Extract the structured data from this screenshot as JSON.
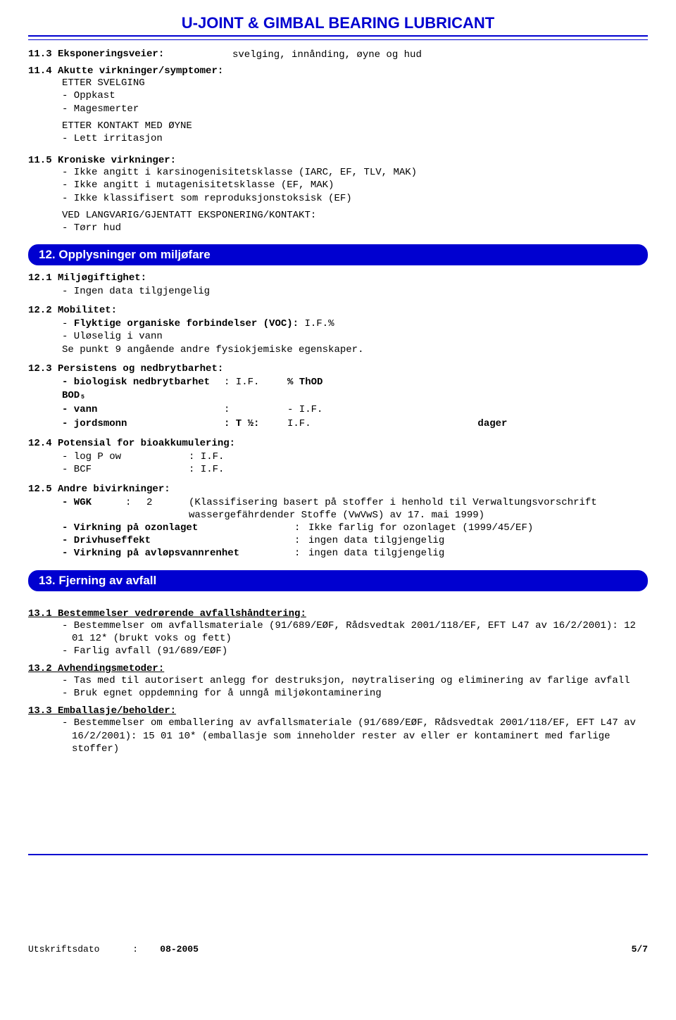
{
  "title": "U-JOINT & GIMBAL BEARING LUBRICANT",
  "s11_3": {
    "label": "11.3 Eksponeringsveier:",
    "value": "svelging, innånding, øyne og hud"
  },
  "s11_4": {
    "label": "11.4 Akutte virkninger/symptomer:",
    "group1_title": "ETTER SVELGING",
    "group1_items": [
      "- Oppkast",
      "- Magesmerter"
    ],
    "group2_title": "ETTER KONTAKT MED ØYNE",
    "group2_items": [
      "- Lett irritasjon"
    ]
  },
  "s11_5": {
    "label": "11.5 Kroniske virkninger:",
    "items": [
      "- Ikke angitt i karsinogenisitetsklasse (IARC, EF, TLV, MAK)",
      "- Ikke angitt i mutagenisitetsklasse (EF, MAK)",
      "- Ikke klassifisert som reproduksjonstoksisk (EF)"
    ],
    "note_title": "VED LANGVARIG/GJENTATT EKSPONERING/KONTAKT:",
    "note_items": [
      "- Tørr hud"
    ]
  },
  "s12": {
    "header": "12.  Opplysninger om miljøfare",
    "s12_1": {
      "label": "12.1 Miljøgiftighet:",
      "items": [
        "- Ingen data tilgjengelig"
      ]
    },
    "s12_2": {
      "label": "12.2 Mobilitet:",
      "item1_pre": "- ",
      "item1_bold": "Flyktige organiske forbindelser (VOC): ",
      "item1_val": "I.F.%",
      "item2": "- Uløselig i vann",
      "item3": "Se punkt 9 angående andre fysiokjemiske egenskaper."
    },
    "s12_3": {
      "label": "12.3 Persistens og nedbrytbarhet:",
      "row1": {
        "c1": "- biologisk nedbrytbarhet BOD₅",
        "c2": ": I.F.",
        "c3": "% ThOD"
      },
      "row2": {
        "c1": "- vann",
        "c2": ":",
        "c3": "- I.F."
      },
      "row3": {
        "c1": "- jordsmonn",
        "c2": ": T ½:",
        "c3_val": "I.F.",
        "c3_unit": "dager"
      }
    },
    "s12_4": {
      "label": "12.4 Potensial for bioakkumulering:",
      "row1": {
        "c1": "- log P ow",
        "c2": ": I.F."
      },
      "row2": {
        "c1": "- BCF",
        "c2": ": I.F."
      }
    },
    "s12_5": {
      "label": "12.5 Andre bivirkninger:",
      "wgk_label": "- WGK",
      "wgk_sep": ":",
      "wgk_val": "2",
      "wgk_desc": "(Klassifisering basert på stoffer i henhold til Verwaltungsvorschrift wassergefährdender Stoffe (VwVwS) av 17. mai 1999)",
      "row2": {
        "label": "- Virkning på ozonlaget",
        "sep": ":",
        "val": "Ikke farlig for ozonlaget (1999/45/EF)"
      },
      "row3": {
        "label": "- Drivhuseffekt",
        "sep": ":",
        "val": "ingen data tilgjengelig"
      },
      "row4": {
        "label": "- Virkning på avløpsvannrenhet",
        "sep": ":",
        "val": "ingen data tilgjengelig"
      }
    }
  },
  "s13": {
    "header": "13.  Fjerning av avfall",
    "s13_1": {
      "label": "13.1 Bestemmelser vedrørende avfallshåndtering:",
      "items": [
        "- Bestemmelser om avfallsmateriale (91/689/EØF, Rådsvedtak 2001/118/EF, EFT L47 av 16/2/2001): 12 01 12* (brukt voks og fett)",
        "- Farlig avfall (91/689/EØF)"
      ]
    },
    "s13_2": {
      "label": "13.2 Avhendingsmetoder:",
      "items": [
        "- Tas med til autorisert anlegg for destruksjon, nøytralisering og eliminering av farlige avfall",
        "- Bruk egnet oppdemning for å unngå miljøkontaminering"
      ]
    },
    "s13_3": {
      "label": "13.3 Emballasje/beholder:",
      "items": [
        "- Bestemmelser om emballering av avfallsmateriale (91/689/EØF, Rådsvedtak 2001/118/EF, EFT L47 av 16/2/2001): 15 01 10* (emballasje som inneholder rester av eller er kontaminert med farlige stoffer)"
      ]
    }
  },
  "footer": {
    "left_label": "Utskriftsdato",
    "left_sep": ":",
    "left_val": "08-2005",
    "right": "5/7"
  }
}
